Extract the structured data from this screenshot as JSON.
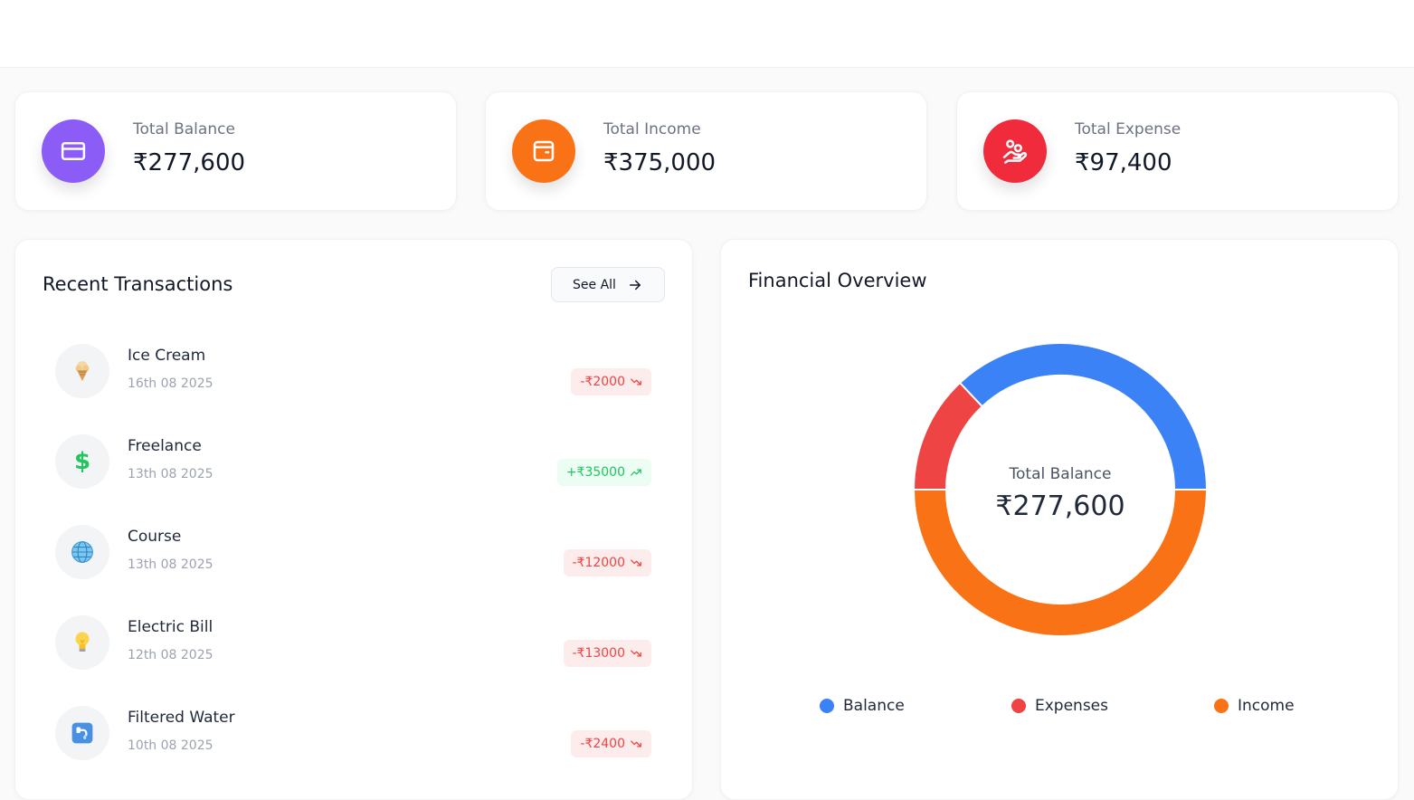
{
  "colors": {
    "purple": "#8b5cf6",
    "orange": "#f97316",
    "red": "#ef2b3c",
    "blue": "#3b82f6",
    "donut_red": "#ef4444",
    "donut_orange": "#f97316"
  },
  "stats": [
    {
      "label": "Total Balance",
      "value": "₹277,600",
      "icon": "credit-card-icon"
    },
    {
      "label": "Total Income",
      "value": "₹375,000",
      "icon": "wallet-icon"
    },
    {
      "label": "Total Expense",
      "value": "₹97,400",
      "icon": "hand-coins-icon"
    }
  ],
  "transactions_panel": {
    "title": "Recent Transactions",
    "see_all_label": "See All",
    "items": [
      {
        "title": "Ice Cream",
        "date": "16th 08 2025",
        "amount": "-₹2000",
        "direction": "down",
        "icon": "ice-cream-icon"
      },
      {
        "title": "Freelance",
        "date": "13th 08 2025",
        "amount": "+₹35000",
        "direction": "up",
        "icon": "dollar-icon"
      },
      {
        "title": "Course",
        "date": "13th 08 2025",
        "amount": "-₹12000",
        "direction": "down",
        "icon": "globe-icon"
      },
      {
        "title": "Electric Bill",
        "date": "12th 08 2025",
        "amount": "-₹13000",
        "direction": "down",
        "icon": "light-bulb-icon"
      },
      {
        "title": "Filtered Water",
        "date": "10th 08 2025",
        "amount": "-₹2400",
        "direction": "down",
        "icon": "water-tap-icon"
      }
    ]
  },
  "overview_panel": {
    "title": "Financial Overview",
    "center_label": "Total Balance",
    "center_value": "₹277,600",
    "legend": [
      {
        "label": "Balance",
        "color": "#3b82f6"
      },
      {
        "label": "Expenses",
        "color": "#ef4444"
      },
      {
        "label": "Income",
        "color": "#f97316"
      }
    ]
  },
  "chart_data": {
    "type": "pie",
    "categories": [
      "Balance",
      "Expenses",
      "Income"
    ],
    "values": [
      277600,
      97400,
      375000
    ]
  }
}
